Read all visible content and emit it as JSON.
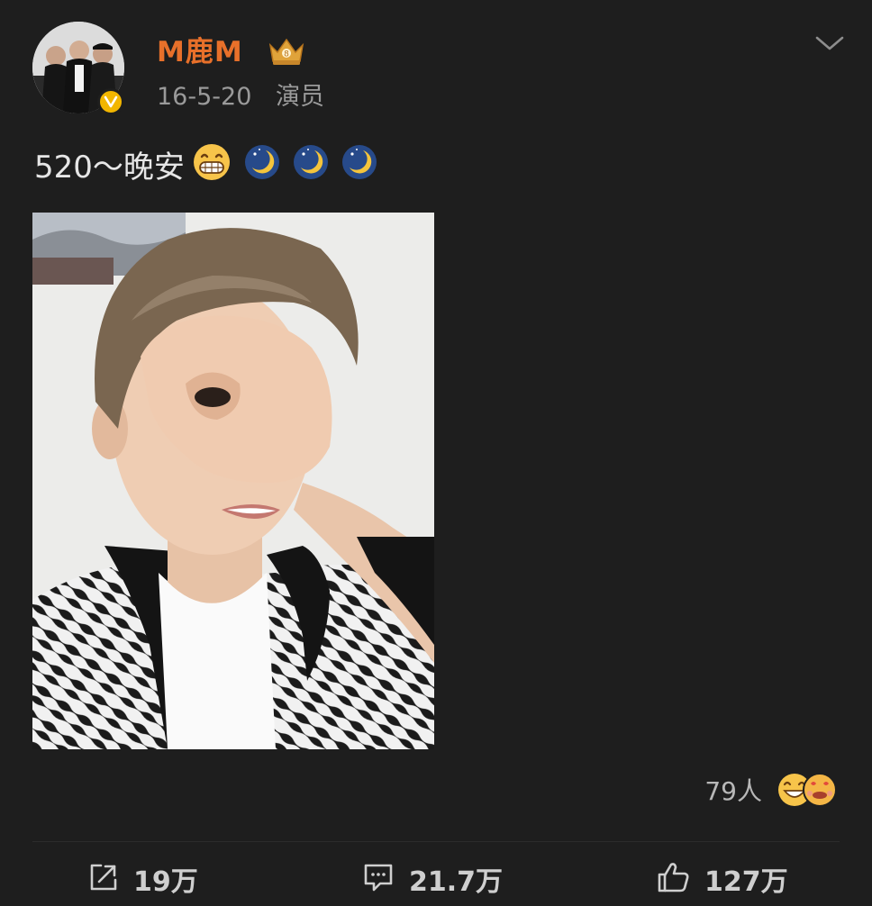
{
  "post": {
    "author": {
      "name": "M鹿M",
      "badge_icon": "crown-icon",
      "verified_icon": "verified-badge-icon",
      "name_color": "#e8702a"
    },
    "meta": {
      "date": "16-5-20",
      "source": "演员"
    },
    "text": "520～晚安",
    "text_emojis": [
      "grin-emoji",
      "moon-emoji",
      "moon-emoji",
      "moon-emoji"
    ],
    "reactions": {
      "count": "79人",
      "icons": [
        "laughing-emoji",
        "heart-eyes-emoji"
      ]
    },
    "actions": {
      "repost": {
        "icon": "share-icon",
        "label": "19万"
      },
      "comment": {
        "icon": "comment-icon",
        "label": "21.7万"
      },
      "like": {
        "icon": "thumbs-up-icon",
        "label": "127万"
      }
    }
  }
}
